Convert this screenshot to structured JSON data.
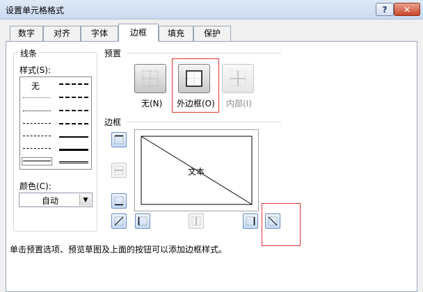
{
  "window": {
    "title": "设置单元格格式",
    "help_label": "?",
    "close_label": "✕"
  },
  "tabs": [
    {
      "label": "数字"
    },
    {
      "label": "对齐"
    },
    {
      "label": "字体"
    },
    {
      "label": "边框"
    },
    {
      "label": "填充"
    },
    {
      "label": "保护"
    }
  ],
  "line": {
    "group_label": "线条",
    "style_label": "样式(S):",
    "none_label": "无",
    "color_label": "颜色(C):",
    "color_value": "自动"
  },
  "presets": {
    "group_label": "预置",
    "none_label": "无(N)",
    "outline_label": "外边框(O)",
    "inside_label": "内部(I)"
  },
  "border": {
    "group_label": "边框",
    "preview_text": "文本"
  },
  "hint": "单击预置选项、预览草图及上面的按钮可以添加边框样式。",
  "colors": {
    "highlight": "#e03030",
    "tab_border": "#9aa6b8"
  }
}
